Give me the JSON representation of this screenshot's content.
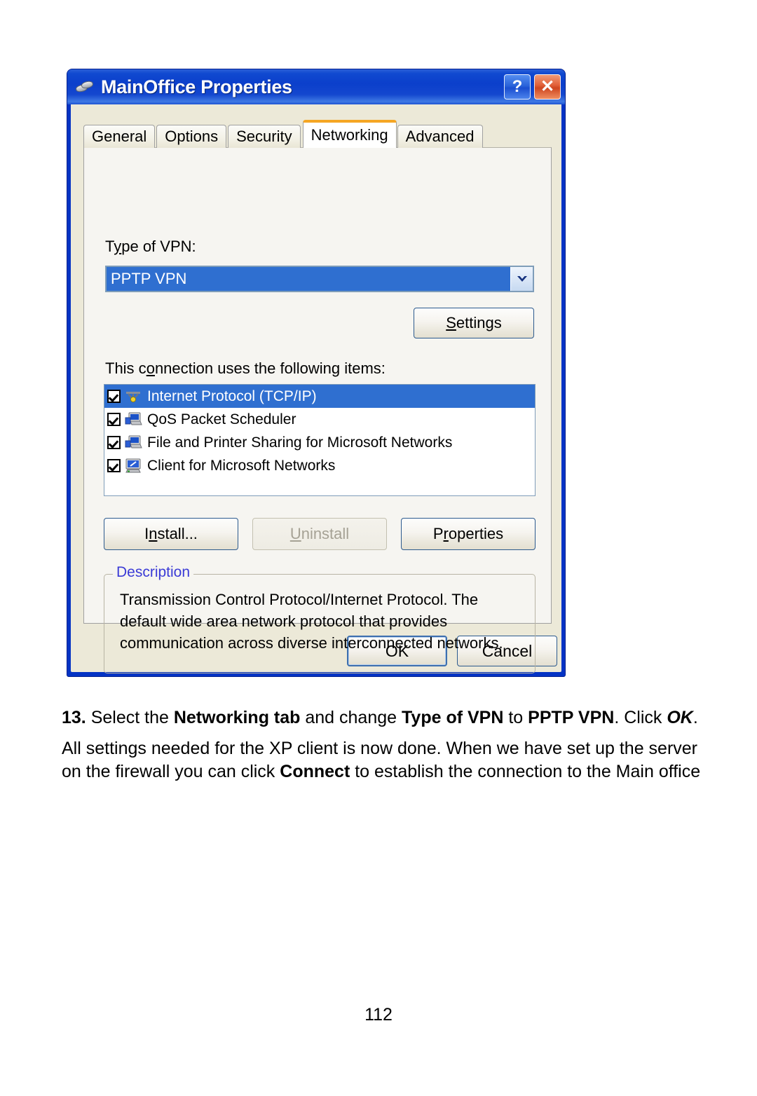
{
  "dialog": {
    "title": "MainOffice Properties",
    "icon": "network-connection-icon",
    "help_button": "?",
    "close_button": "✕",
    "tabs": [
      {
        "label": "General",
        "active": false
      },
      {
        "label": "Options",
        "active": false
      },
      {
        "label": "Security",
        "active": false
      },
      {
        "label": "Networking",
        "active": true
      },
      {
        "label": "Advanced",
        "active": false
      }
    ],
    "networking": {
      "vpn_type_label": "Type of VPN:",
      "vpn_type_value": "PPTP VPN",
      "settings_button": "Settings",
      "items_label": "This connection uses the following items:",
      "items": [
        {
          "label": "Internet Protocol (TCP/IP)",
          "checked": true,
          "selected": true,
          "icon": "tcpip-protocol-icon"
        },
        {
          "label": "QoS Packet Scheduler",
          "checked": true,
          "selected": false,
          "icon": "network-service-icon"
        },
        {
          "label": "File and Printer Sharing for Microsoft Networks",
          "checked": true,
          "selected": false,
          "icon": "network-service-icon"
        },
        {
          "label": "Client for Microsoft Networks",
          "checked": true,
          "selected": false,
          "icon": "network-client-icon"
        }
      ],
      "install_button": "Install...",
      "uninstall_button": "Uninstall",
      "properties_button": "Properties",
      "description_legend": "Description",
      "description_text": "Transmission Control Protocol/Internet Protocol. The default wide area network protocol that provides communication across diverse interconnected networks."
    },
    "ok_button": "OK",
    "cancel_button": "Cancel"
  },
  "document": {
    "step": {
      "number": "13.",
      "part1": " Select the ",
      "bold1": "Networking tab",
      "part2": " and change ",
      "bold2": "Type of VPN",
      "part3": " to ",
      "bold3": "PPTP VPN",
      "part4": ". Click ",
      "italic1": "OK",
      "part5": "."
    },
    "paragraph": {
      "part1": "All settings needed for the XP client is now done. When we have set up the server on the firewall you can click ",
      "bold1": "Connect",
      "part2": " to establish the connection to the Main office"
    },
    "page_number": "112"
  },
  "colors": {
    "title_bar_blue": "#0b3fcb",
    "dialog_face": "#ece9d8",
    "selection_blue": "#2f6fd0",
    "active_tab_accent": "#f5a623",
    "legend_blue": "#3b3bd6",
    "close_button_red": "#cf4620"
  }
}
